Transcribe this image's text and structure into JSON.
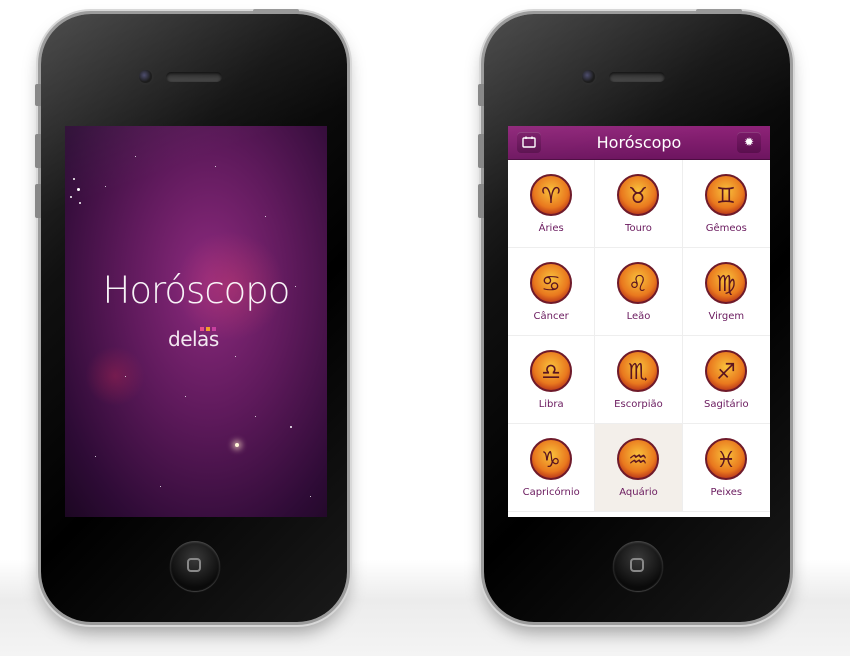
{
  "splash": {
    "title": "Horóscopo",
    "brand": "delas",
    "brand_colors": [
      "#e84b8a",
      "#f2a12a",
      "#c93fa0"
    ],
    "background_color": "#5f1a5c"
  },
  "app": {
    "header_title": "Horóscopo",
    "header_color": "#7d1b6c",
    "left_icon": "calendar-icon",
    "right_icon": "gear-icon",
    "label_color": "#6a1a5e",
    "signs": [
      {
        "label": "Áries",
        "icon": "aries-icon"
      },
      {
        "label": "Touro",
        "icon": "taurus-icon"
      },
      {
        "label": "Gêmeos",
        "icon": "gemini-icon"
      },
      {
        "label": "Câncer",
        "icon": "cancer-icon"
      },
      {
        "label": "Leão",
        "icon": "leo-icon"
      },
      {
        "label": "Virgem",
        "icon": "virgo-icon"
      },
      {
        "label": "Libra",
        "icon": "libra-icon"
      },
      {
        "label": "Escorpião",
        "icon": "scorpio-icon"
      },
      {
        "label": "Sagitário",
        "icon": "sagittarius-icon"
      },
      {
        "label": "Capricórnio",
        "icon": "capricorn-icon"
      },
      {
        "label": "Aquário",
        "icon": "aquarius-icon"
      },
      {
        "label": "Peixes",
        "icon": "pisces-icon"
      }
    ]
  }
}
